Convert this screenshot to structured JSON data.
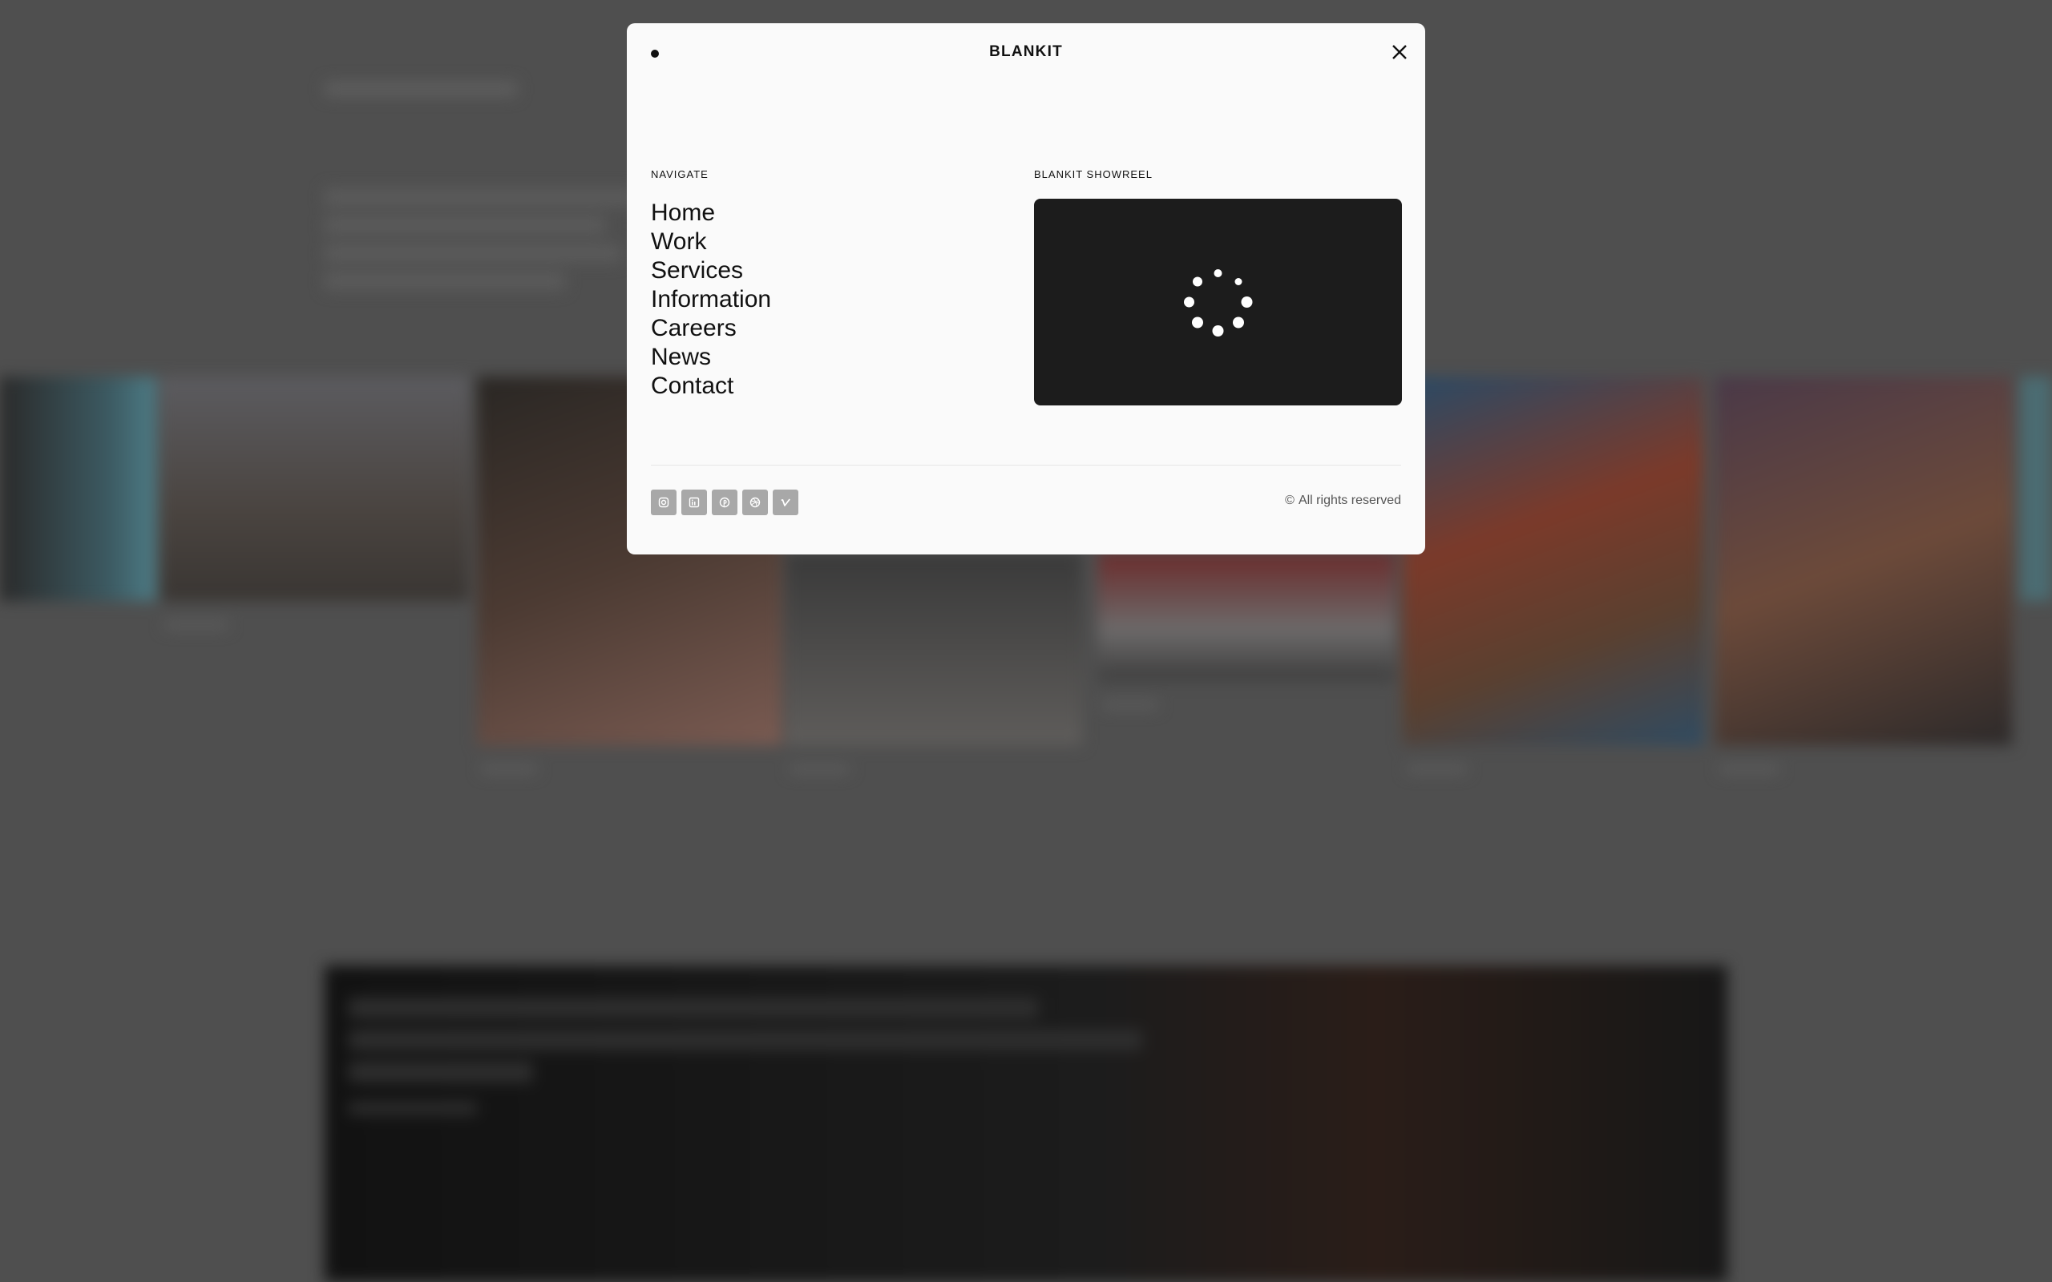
{
  "modal": {
    "brand": "BLANKIT",
    "navigate_label": "NAVIGATE",
    "showreel_label": "BLANKIT SHOWREEL",
    "nav_items": [
      {
        "label": "Home"
      },
      {
        "label": "Work"
      },
      {
        "label": "Services"
      },
      {
        "label": "Information"
      },
      {
        "label": "Careers"
      },
      {
        "label": "News"
      },
      {
        "label": "Contact"
      }
    ],
    "socials": [
      "instagram-icon",
      "linkedin-icon",
      "pinterest-icon",
      "dribbble-icon",
      "vimeo-icon"
    ],
    "copyright_symbol": "©",
    "copyright_text": "All rights reserved"
  },
  "colors": {
    "overlay": "#4f4f4f",
    "modal_bg": "#fafafa",
    "video_bg": "#1c1c1c",
    "social_bg": "#a8a8a8"
  }
}
